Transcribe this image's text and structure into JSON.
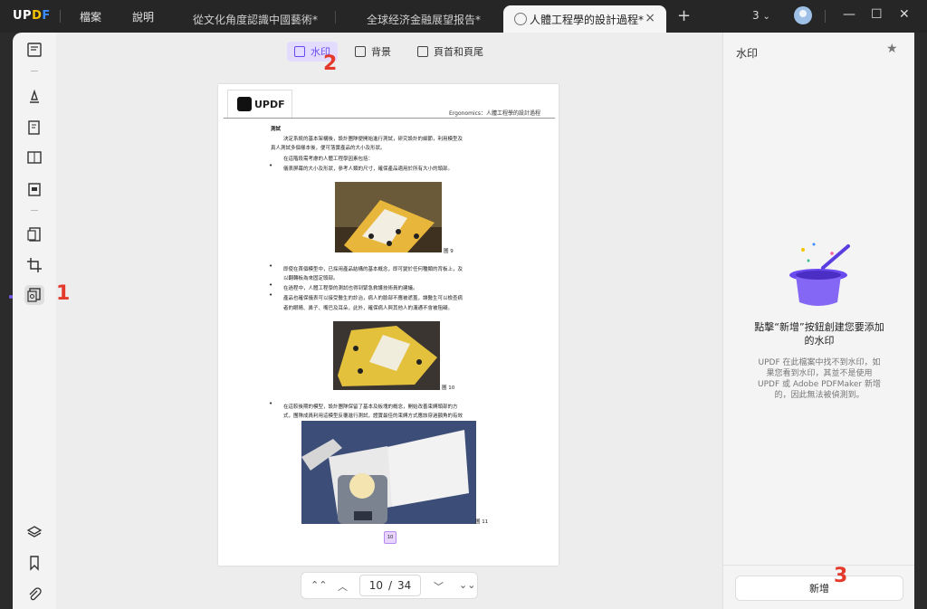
{
  "titlebar": {
    "logo": {
      "u": "UP",
      "o": "D",
      "d": "F"
    },
    "menus": [
      "檔案",
      "說明"
    ],
    "tabs": [
      {
        "label": "從文化角度認識中國藝術*",
        "active": false
      },
      {
        "label": "全球经济金融展望报告*",
        "active": false
      },
      {
        "label": "人體工程學的設計過程*",
        "active": true
      }
    ],
    "tab_close": "×",
    "new_tab": "+",
    "open_count": "3",
    "window": {
      "minimize": "—",
      "maximize": "☐",
      "close": "✕"
    }
  },
  "subtoolbar": {
    "items": [
      {
        "label": "水印",
        "active": true
      },
      {
        "label": "背景",
        "active": false
      },
      {
        "label": "頁首和頁尾",
        "active": false
      }
    ]
  },
  "page": {
    "logo_text": "UPDF",
    "header": "Ergonomics：人體工程學的設計過程",
    "lines": [
      "測試",
      "決定系統的基本架構後，設計團隊便開始進行測試，研究設計的細節，利用模型及",
      "真人測試多個樣本後，便可落實產品的大小及形狀。",
      "在這階段需考慮的人體工程學因素包括：",
      "儀表屏幕的大小及形狀，參考人類的尺寸，確保產品適用於所有大小的頭部。",
      "即使在首個模型中，已採用產品結構的基本概念，即可變於任何種類的背板上，及",
      "以翻轉板為來固定頭部。",
      "在過程中，人體工程學的測試也得到緊急救護技術員的建議。",
      "產品也確保儀表可以接受醫生的診治，病人的臉部不應被遮蓋，讓醫生可以檢查病",
      "者的眼睛、鼻子、嘴巴及耳朵，此外，確保病人與其他人的溝通不會被阻礙。",
      "在這較後期的模型，設計團隊保留了基本及板塊的概念，開始改善束縛頭部的方",
      "式，團隊成員利用這模型反覆進行測試，證實最佳的束縛方式應該穿過額角的有效"
    ],
    "bullet": "•",
    "figures": [
      "圖 9",
      "圖 10",
      "圖 11"
    ],
    "page_badge": "10"
  },
  "pager": {
    "first": "⌃⌃",
    "prev": "︿",
    "current": "10",
    "separator": "/",
    "total": "34",
    "next": "﹀",
    "last": "⌄⌄"
  },
  "rightpanel": {
    "title": "水印",
    "star": "★",
    "message": "點擊“新增”按鈕創建您要添加\n的水印",
    "note": "UPDF 在此檔案中找不到水印，如\n果您看到水印，其並不是使用\nUPDF 或 Adobe PDFMaker 新增\n的，因此無法被偵測到。",
    "add_button": "新增"
  },
  "annotations": [
    "1",
    "2",
    "3"
  ],
  "colors": {
    "accent": "#6a4af0",
    "annotation": "#e33a2c",
    "titlebar": "#262626"
  }
}
